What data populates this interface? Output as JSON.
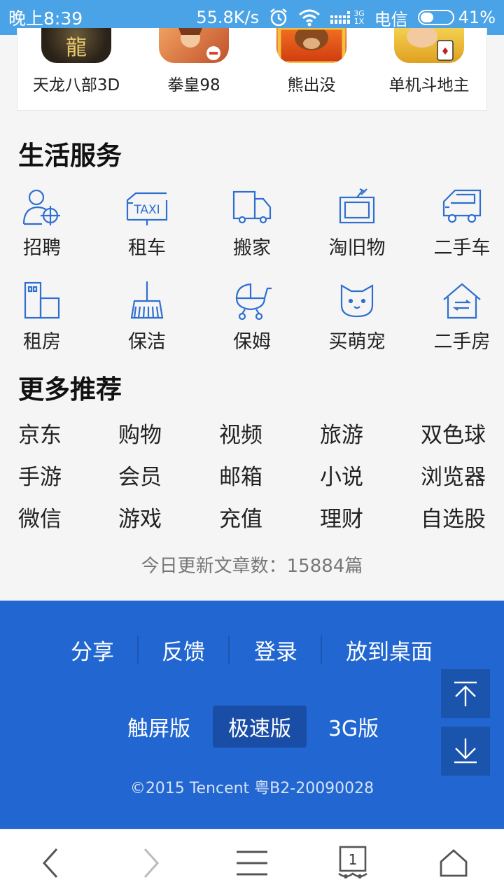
{
  "status_bar": {
    "time": "晚上8:39",
    "speed": "55.8K/s",
    "network_small_top": "3G",
    "network_small_bottom": "1X",
    "carrier": "电信",
    "battery_text": "41%",
    "battery_level": 0.41
  },
  "games": [
    {
      "name": "天龙八部3D",
      "icon": "game-tianlong-icon"
    },
    {
      "name": "拳皇98",
      "icon": "game-kof98-icon"
    },
    {
      "name": "熊出没",
      "icon": "game-boonie-bears-icon"
    },
    {
      "name": "单机斗地主",
      "icon": "game-doudizhu-icon"
    }
  ],
  "life_services": {
    "title": "生活服务",
    "items": [
      {
        "label": "招聘",
        "icon": "recruit-icon"
      },
      {
        "label": "租车",
        "icon": "taxi-icon"
      },
      {
        "label": "搬家",
        "icon": "truck-icon"
      },
      {
        "label": "淘旧物",
        "icon": "tv-icon"
      },
      {
        "label": "二手车",
        "icon": "car-icon"
      },
      {
        "label": "租房",
        "icon": "building-icon"
      },
      {
        "label": "保洁",
        "icon": "broom-icon"
      },
      {
        "label": "保姆",
        "icon": "stroller-icon"
      },
      {
        "label": "买萌宠",
        "icon": "cat-icon"
      },
      {
        "label": "二手房",
        "icon": "house-icon"
      }
    ]
  },
  "more_recommend": {
    "title": "更多推荐",
    "rows": [
      [
        "京东",
        "购物",
        "视频",
        "旅游",
        "双色球"
      ],
      [
        "手游",
        "会员",
        "邮箱",
        "小说",
        "浏览器"
      ],
      [
        "微信",
        "游戏",
        "充值",
        "理财",
        "自选股"
      ]
    ]
  },
  "update_count": "今日更新文章数：15884篇",
  "footer": {
    "links": [
      "分享",
      "反馈",
      "登录",
      "放到桌面"
    ],
    "versions": [
      "触屏版",
      "极速版",
      "3G版"
    ],
    "active_version": "极速版",
    "copyright": "©2015 Tencent 粤B2-20090028",
    "accent": "#2166d1"
  },
  "bottom_nav": {
    "tab_count": "1"
  },
  "colors": {
    "status_bar": "#4aa3e6",
    "icon_blue": "#2f6fd0",
    "footer_bg": "#2166d1"
  }
}
